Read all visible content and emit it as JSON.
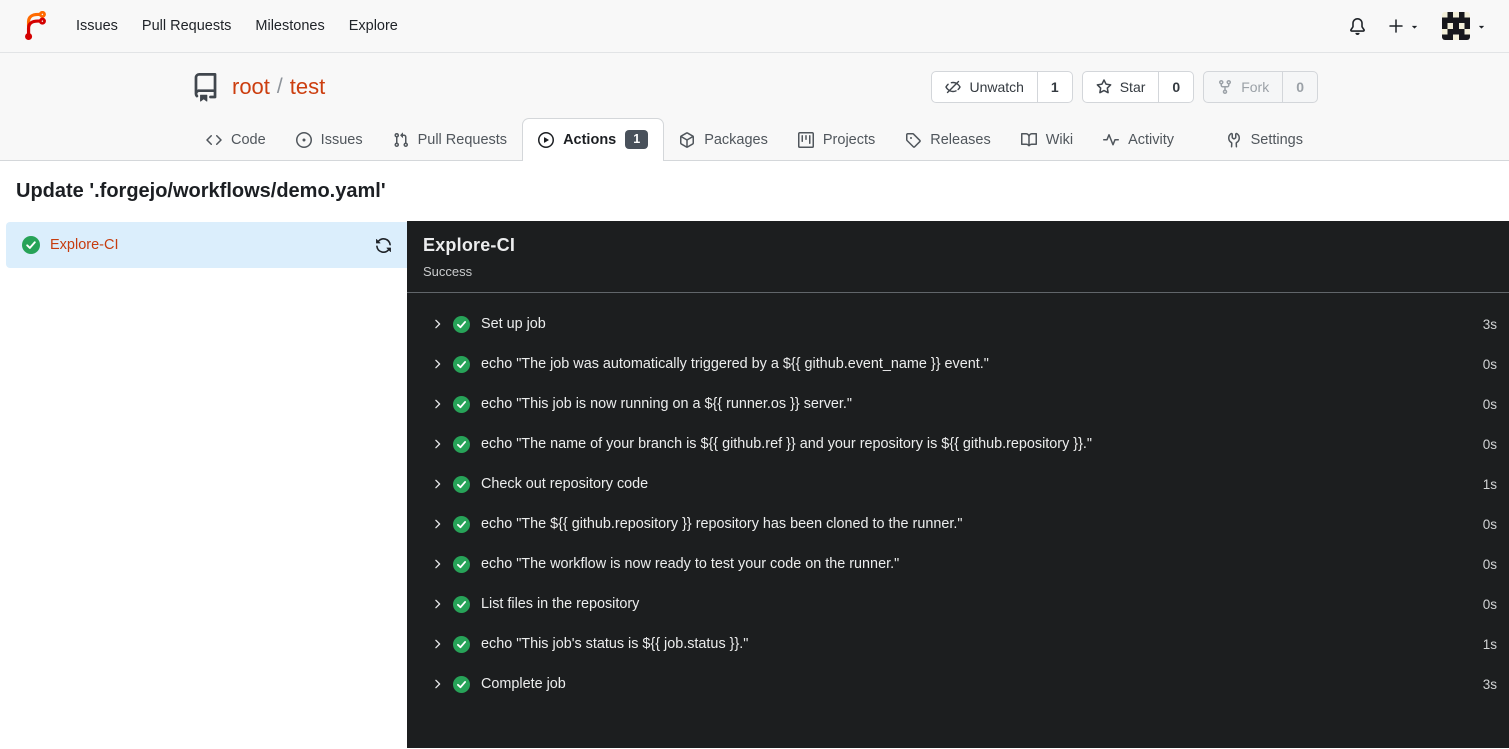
{
  "colors": {
    "primary_link": "#cc3e0f",
    "success_green": "#27a358",
    "selected_job_bg": "#dbeefc",
    "panel_bg": "#1c1e1f",
    "badge_bg": "#49515b",
    "header_bg": "#f8f8f8"
  },
  "navbar": {
    "items": [
      {
        "label": "Issues"
      },
      {
        "label": "Pull Requests"
      },
      {
        "label": "Milestones"
      },
      {
        "label": "Explore"
      }
    ],
    "right_icons": [
      "bell-icon",
      "plus-dropdown",
      "avatar-dropdown"
    ]
  },
  "repo": {
    "owner": "root",
    "separator": "/",
    "name": "test",
    "buttons": {
      "unwatch": {
        "label": "Unwatch",
        "count": "1",
        "icon": "eye-slash-icon"
      },
      "star": {
        "label": "Star",
        "count": "0",
        "icon": "star-icon"
      },
      "fork": {
        "label": "Fork",
        "count": "0",
        "icon": "fork-icon",
        "disabled": true
      }
    },
    "tabs": [
      {
        "label": "Code",
        "icon": "code-icon"
      },
      {
        "label": "Issues",
        "icon": "issue-opened-icon"
      },
      {
        "label": "Pull Requests",
        "icon": "pull-request-icon"
      },
      {
        "label": "Actions",
        "icon": "play-circle-icon",
        "badge": "1",
        "active": true
      },
      {
        "label": "Packages",
        "icon": "package-icon"
      },
      {
        "label": "Projects",
        "icon": "project-icon"
      },
      {
        "label": "Releases",
        "icon": "tag-icon"
      },
      {
        "label": "Wiki",
        "icon": "book-icon"
      },
      {
        "label": "Activity",
        "icon": "pulse-icon"
      },
      {
        "label": "Settings",
        "icon": "tools-icon"
      }
    ]
  },
  "run": {
    "title": "Update '.forgejo/workflows/demo.yaml'",
    "sidebar_job": {
      "name": "Explore-CI",
      "status": "success"
    },
    "panel": {
      "title": "Explore-CI",
      "status": "Success"
    },
    "steps": [
      {
        "name": "Set up job",
        "duration": "3s"
      },
      {
        "name": "echo \"The job was automatically triggered by a ${{ github.event_name }} event.\"",
        "duration": "0s"
      },
      {
        "name": "echo \"This job is now running on a ${{ runner.os }} server.\"",
        "duration": "0s"
      },
      {
        "name": "echo \"The name of your branch is ${{ github.ref }} and your repository is ${{ github.repository }}.\"",
        "duration": "0s"
      },
      {
        "name": "Check out repository code",
        "duration": "1s"
      },
      {
        "name": "echo \"The ${{ github.repository }} repository has been cloned to the runner.\"",
        "duration": "0s"
      },
      {
        "name": "echo \"The workflow is now ready to test your code on the runner.\"",
        "duration": "0s"
      },
      {
        "name": "List files in the repository",
        "duration": "0s"
      },
      {
        "name": "echo \"This job's status is ${{ job.status }}.\"",
        "duration": "1s"
      },
      {
        "name": "Complete job",
        "duration": "3s"
      }
    ]
  }
}
